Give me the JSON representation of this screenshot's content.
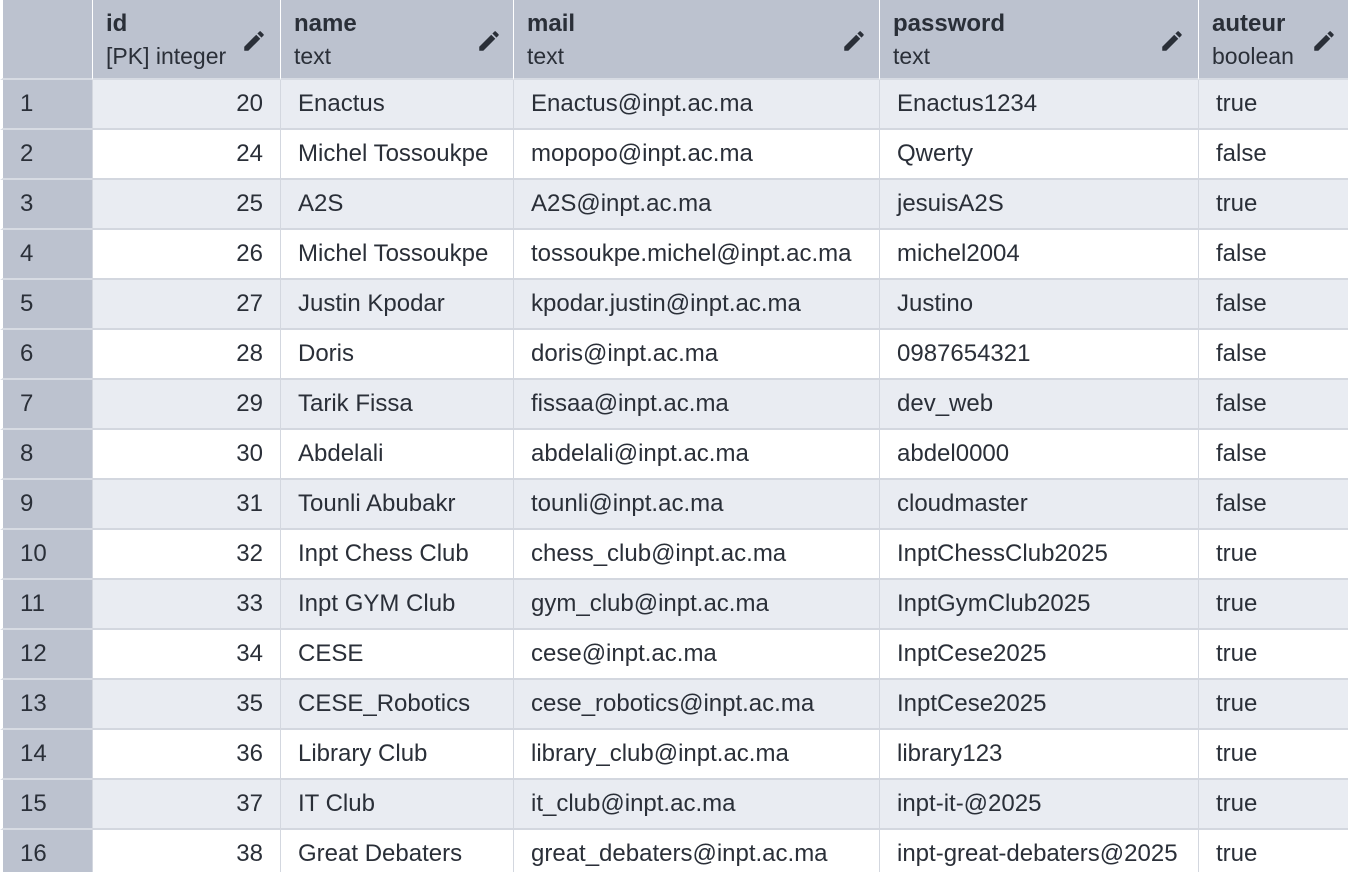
{
  "columns": [
    {
      "name": "id",
      "type": "[PK] integer"
    },
    {
      "name": "name",
      "type": "text"
    },
    {
      "name": "mail",
      "type": "text"
    },
    {
      "name": "password",
      "type": "text"
    },
    {
      "name": "auteur",
      "type": "boolean"
    }
  ],
  "rows": [
    {
      "n": "1",
      "id": "20",
      "name": "Enactus",
      "mail": "Enactus@inpt.ac.ma",
      "password": "Enactus1234",
      "auteur": "true"
    },
    {
      "n": "2",
      "id": "24",
      "name": "Michel Tossoukpe",
      "mail": "mopopo@inpt.ac.ma",
      "password": "Qwerty",
      "auteur": "false"
    },
    {
      "n": "3",
      "id": "25",
      "name": "A2S",
      "mail": "A2S@inpt.ac.ma",
      "password": "jesuisA2S",
      "auteur": "true"
    },
    {
      "n": "4",
      "id": "26",
      "name": "Michel Tossoukpe",
      "mail": "tossoukpe.michel@inpt.ac.ma",
      "password": "michel2004",
      "auteur": "false"
    },
    {
      "n": "5",
      "id": "27",
      "name": "Justin Kpodar",
      "mail": "kpodar.justin@inpt.ac.ma",
      "password": "Justino",
      "auteur": "false"
    },
    {
      "n": "6",
      "id": "28",
      "name": "Doris",
      "mail": "doris@inpt.ac.ma",
      "password": "0987654321",
      "auteur": "false"
    },
    {
      "n": "7",
      "id": "29",
      "name": "Tarik Fissa",
      "mail": "fissaa@inpt.ac.ma",
      "password": "dev_web",
      "auteur": "false"
    },
    {
      "n": "8",
      "id": "30",
      "name": "Abdelali",
      "mail": "abdelali@inpt.ac.ma",
      "password": "abdel0000",
      "auteur": "false"
    },
    {
      "n": "9",
      "id": "31",
      "name": "Tounli Abubakr",
      "mail": "tounli@inpt.ac.ma",
      "password": "cloudmaster",
      "auteur": "false"
    },
    {
      "n": "10",
      "id": "32",
      "name": "Inpt Chess Club",
      "mail": "chess_club@inpt.ac.ma",
      "password": "InptChessClub2025",
      "auteur": "true"
    },
    {
      "n": "11",
      "id": "33",
      "name": "Inpt GYM Club",
      "mail": "gym_club@inpt.ac.ma",
      "password": "InptGymClub2025",
      "auteur": "true"
    },
    {
      "n": "12",
      "id": "34",
      "name": "CESE",
      "mail": "cese@inpt.ac.ma",
      "password": "InptCese2025",
      "auteur": "true"
    },
    {
      "n": "13",
      "id": "35",
      "name": "CESE_Robotics",
      "mail": "cese_robotics@inpt.ac.ma",
      "password": "InptCese2025",
      "auteur": "true"
    },
    {
      "n": "14",
      "id": "36",
      "name": "Library Club",
      "mail": "library_club@inpt.ac.ma",
      "password": "library123",
      "auteur": "true"
    },
    {
      "n": "15",
      "id": "37",
      "name": "IT Club",
      "mail": "it_club@inpt.ac.ma",
      "password": "inpt-it-@2025",
      "auteur": "true"
    },
    {
      "n": "16",
      "id": "38",
      "name": "Great Debaters",
      "mail": "great_debaters@inpt.ac.ma",
      "password": "inpt-great-debaters@2025",
      "auteur": "true"
    }
  ]
}
